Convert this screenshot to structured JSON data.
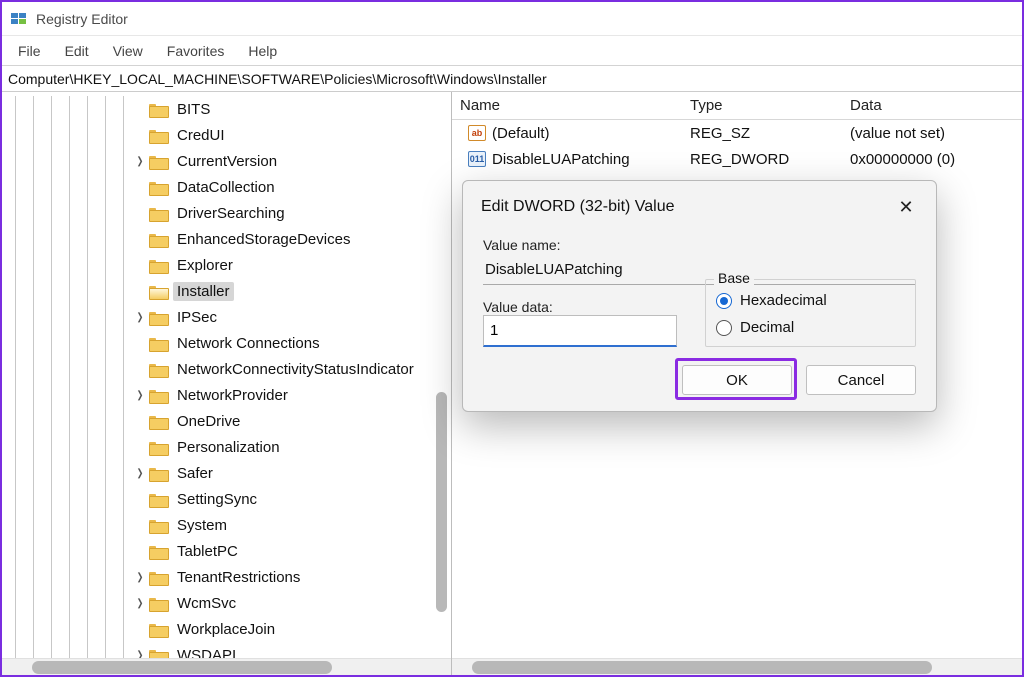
{
  "app": {
    "title": "Registry Editor"
  },
  "menu": {
    "file": "File",
    "edit": "Edit",
    "view": "View",
    "favorites": "Favorites",
    "help": "Help"
  },
  "address": "Computer\\HKEY_LOCAL_MACHINE\\SOFTWARE\\Policies\\Microsoft\\Windows\\Installer",
  "tree": {
    "items": [
      {
        "label": "BITS",
        "expander": ""
      },
      {
        "label": "CredUI",
        "expander": ""
      },
      {
        "label": "CurrentVersion",
        "expander": ">"
      },
      {
        "label": "DataCollection",
        "expander": ""
      },
      {
        "label": "DriverSearching",
        "expander": ""
      },
      {
        "label": "EnhancedStorageDevices",
        "expander": ""
      },
      {
        "label": "Explorer",
        "expander": ""
      },
      {
        "label": "Installer",
        "expander": "",
        "selected": true
      },
      {
        "label": "IPSec",
        "expander": ">"
      },
      {
        "label": "Network Connections",
        "expander": ""
      },
      {
        "label": "NetworkConnectivityStatusIndicator",
        "expander": ""
      },
      {
        "label": "NetworkProvider",
        "expander": ">"
      },
      {
        "label": "OneDrive",
        "expander": ""
      },
      {
        "label": "Personalization",
        "expander": ""
      },
      {
        "label": "Safer",
        "expander": ">"
      },
      {
        "label": "SettingSync",
        "expander": ""
      },
      {
        "label": "System",
        "expander": ""
      },
      {
        "label": "TabletPC",
        "expander": ""
      },
      {
        "label": "TenantRestrictions",
        "expander": ">"
      },
      {
        "label": "WcmSvc",
        "expander": ">"
      },
      {
        "label": "WorkplaceJoin",
        "expander": ""
      },
      {
        "label": "WSDAPI",
        "expander": ">"
      }
    ]
  },
  "list": {
    "headers": {
      "name": "Name",
      "type": "Type",
      "data": "Data"
    },
    "rows": [
      {
        "icon": "str",
        "name": "(Default)",
        "type": "REG_SZ",
        "data": "(value not set)"
      },
      {
        "icon": "dword",
        "name": "DisableLUAPatching",
        "type": "REG_DWORD",
        "data": "0x00000000 (0)"
      }
    ]
  },
  "dialog": {
    "title": "Edit DWORD (32-bit) Value",
    "valueNameLabel": "Value name:",
    "valueName": "DisableLUAPatching",
    "valueDataLabel": "Value data:",
    "valueData": "1",
    "baseLabel": "Base",
    "hexLabel": "Hexadecimal",
    "decLabel": "Decimal",
    "ok": "OK",
    "cancel": "Cancel",
    "close": "✕"
  }
}
